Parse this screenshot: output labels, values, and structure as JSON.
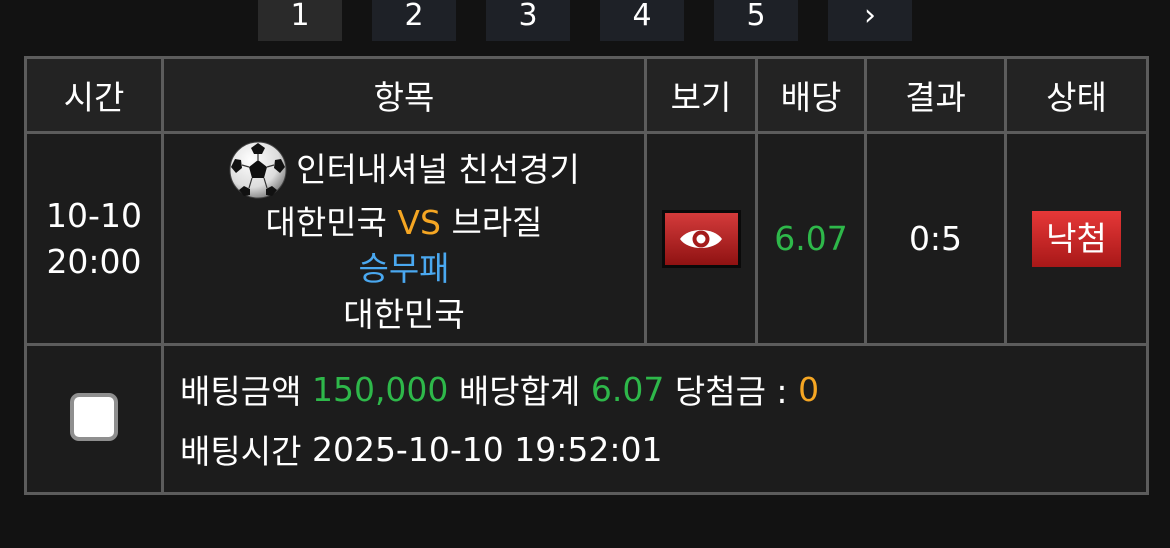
{
  "pagination": [
    "1",
    "2",
    "3",
    "4",
    "5",
    "›"
  ],
  "table": {
    "headers": [
      "시간",
      "항목",
      "보기",
      "배당",
      "결과",
      "상태"
    ],
    "row": {
      "date": "10-10",
      "time": "20:00",
      "league": "인터내셔널 친선경기",
      "home_team": "대한민국",
      "vs": "VS",
      "away_team": "브라질",
      "bet_type": "승무패",
      "pick": "대한민국",
      "view_icon": "eye-icon",
      "odds": "6.07",
      "result": "0:5",
      "status": "낙첨"
    },
    "summary": {
      "amount_label": "배팅금액",
      "amount": "150,000",
      "total_odds_label": "배당합계",
      "total_odds": "6.07",
      "winnings_label": "당첨금 :",
      "winnings": "0",
      "bet_time_label": "배팅시간",
      "bet_time": "2025-10-10 19:52:01"
    }
  },
  "colors": {
    "background": "#121212",
    "odds_green": "#2eb84a",
    "vs_orange": "#f5a623",
    "bet_type_blue": "#4aa8f0",
    "status_red": "#d32f2f"
  }
}
